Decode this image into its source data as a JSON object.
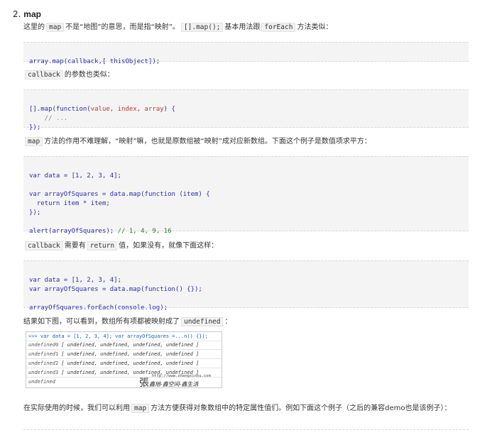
{
  "section": {
    "number": "2.",
    "title": "map"
  },
  "p1": {
    "pre": "这里的",
    "code1": "map",
    "mid": "不是“地图”的意思，而是指“映射”。",
    "code2": "[].map();",
    "mid2": "基本用法跟",
    "code3": "forEach",
    "post": "方法类似："
  },
  "code1": {
    "line1": "array.map(callback,[ thisObject]);"
  },
  "p2": {
    "code": "callback",
    "text": "的参数也类似："
  },
  "code2": {
    "l1a": "[].map(function(",
    "l1b": "value, index, array",
    "l1c": ") {",
    "l2": "    // ...",
    "l3": "});"
  },
  "p3": {
    "code": "map",
    "text": "方法的作用不难理解，“映射”嘛，也就是原数组被“映射”成对应新数组。下面这个例子是数值项求平方："
  },
  "code3": {
    "l1": "var data = [1, 2, 3, 4];",
    "l2": "var arrayOfSquares = data.map(function (item) {",
    "l3": "  return item * item;",
    "l4": "});",
    "l5a": "alert(arrayOfSquares); ",
    "l5b": "// 1, 4, 9, 16"
  },
  "p4": {
    "code1": "callback",
    "mid": "需要有",
    "code2": "return",
    "post": "值，如果没有，就像下面这样："
  },
  "code4": {
    "l1": "var data = [1, 2, 3, 4];",
    "l2": "var arrayOfSquares = data.map(function() {});",
    "l3": "arrayOfSquares.forEach(console.log);"
  },
  "p5": {
    "text": "结果如下图，可以看到，数组所有项都被映射成了",
    "code": "undefined",
    "post": "："
  },
  "console": {
    "input": ">>> var data = [1, 2, 3, 4];    var arrayOfSquares =...n() {});",
    "rows": [
      {
        "label": "undefined",
        "idx": "0",
        "arr": "[ undefined,  undefined,  undefined,  undefined ]"
      },
      {
        "label": "undefined",
        "idx": "1",
        "arr": "[ undefined,  undefined,  undefined,  undefined ]"
      },
      {
        "label": "undefined",
        "idx": "2",
        "arr": "[ undefined,  undefined,  undefined,  undefined ]"
      },
      {
        "label": "undefined",
        "idx": "3",
        "arr": "[ undefined,  undefined,  undefined,  undefined ]"
      }
    ],
    "last": "undefined",
    "watermark_url": "http://www.zhangxinxu.com",
    "watermark_text": "鑫旭-鑫空间-鑫生活",
    "watermark_logo": "張"
  },
  "p6": {
    "pre": "在实际使用的时候，我们可以利用",
    "code": "map",
    "post": "方法方便获得对象数组中的特定属性值们。例如下面这个例子（之后的兼容demo也是该例子）："
  }
}
